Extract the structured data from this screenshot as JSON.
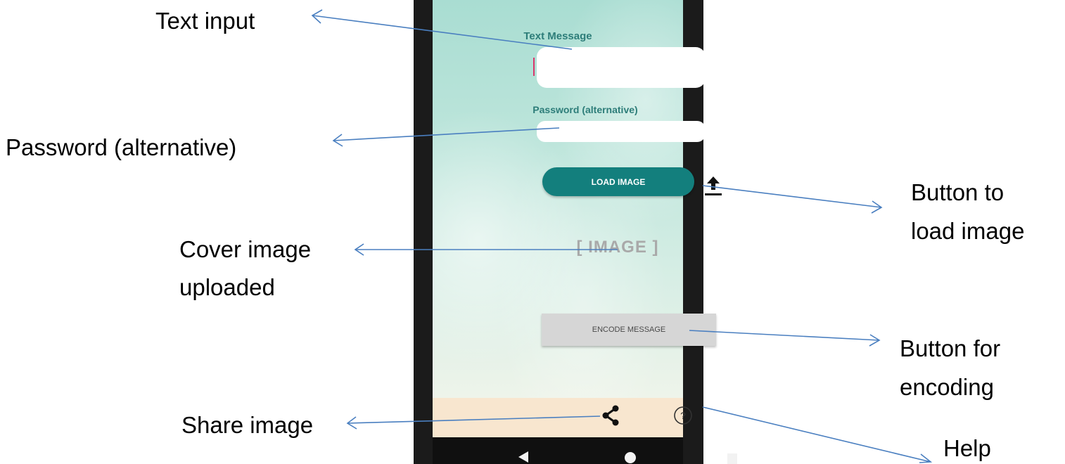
{
  "app": {
    "text_message_label": "Text Message",
    "text_message_value": "",
    "password_label": "Password (alternative)",
    "password_value": "",
    "load_image_button": "LOAD IMAGE",
    "image_placeholder": "[ IMAGE ]",
    "encode_button": "ENCODE MESSAGE",
    "icons": {
      "upload": "upload-icon",
      "share": "share-icon",
      "help": "help-icon",
      "nav_back": "back-triangle-icon",
      "nav_home": "home-circle-icon",
      "nav_recent": "recents-square-icon"
    },
    "colors": {
      "accent": "#137f7d",
      "label": "#2d7d79",
      "bottom_bar": "#f8e6cf",
      "cursor": "#d9366c",
      "arrow": "#4a7fc0"
    }
  },
  "callouts": {
    "text_input": "Text input",
    "password": "Password (alternative)",
    "cover_image_line1": "Cover image",
    "cover_image_line2": "uploaded",
    "load_button_line1": "Button to",
    "load_button_line2": "load image",
    "encode_button_line1": "Button for",
    "encode_button_line2": "encoding",
    "share": "Share image",
    "help": "Help"
  }
}
